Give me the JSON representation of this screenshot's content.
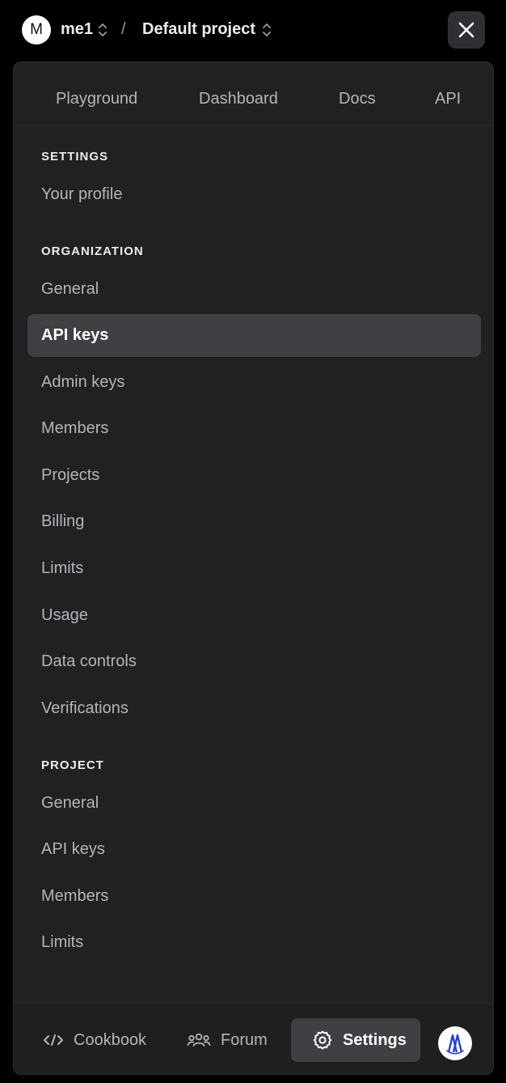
{
  "header": {
    "avatar_initial": "M",
    "org_name": "me1",
    "separator": "/",
    "project_name": "Default project"
  },
  "top_tabs": [
    {
      "label": "Playground"
    },
    {
      "label": "Dashboard"
    },
    {
      "label": "Docs"
    },
    {
      "label": "API"
    }
  ],
  "sections": {
    "settings": {
      "heading": "SETTINGS",
      "items": [
        {
          "label": "Your profile"
        }
      ]
    },
    "organization": {
      "heading": "ORGANIZATION",
      "items": [
        {
          "label": "General"
        },
        {
          "label": "API keys"
        },
        {
          "label": "Admin keys"
        },
        {
          "label": "Members"
        },
        {
          "label": "Projects"
        },
        {
          "label": "Billing"
        },
        {
          "label": "Limits"
        },
        {
          "label": "Usage"
        },
        {
          "label": "Data controls"
        },
        {
          "label": "Verifications"
        }
      ]
    },
    "project": {
      "heading": "PROJECT",
      "items": [
        {
          "label": "General"
        },
        {
          "label": "API keys"
        },
        {
          "label": "Members"
        },
        {
          "label": "Limits"
        }
      ]
    }
  },
  "bottom_bar": {
    "cookbook_label": "Cookbook",
    "forum_label": "Forum",
    "settings_label": "Settings"
  },
  "icons": {
    "close": "close-icon",
    "cookbook": "code-icon",
    "forum": "people-icon",
    "settings": "gear-icon",
    "brand": "brand-logo-icon"
  },
  "colors": {
    "background": "#000000",
    "panel": "#212124",
    "active_item": "#3f3f44",
    "text_primary": "#ececf1",
    "text_secondary": "#b4b4bb",
    "brand_blue": "#2a3fd6"
  }
}
